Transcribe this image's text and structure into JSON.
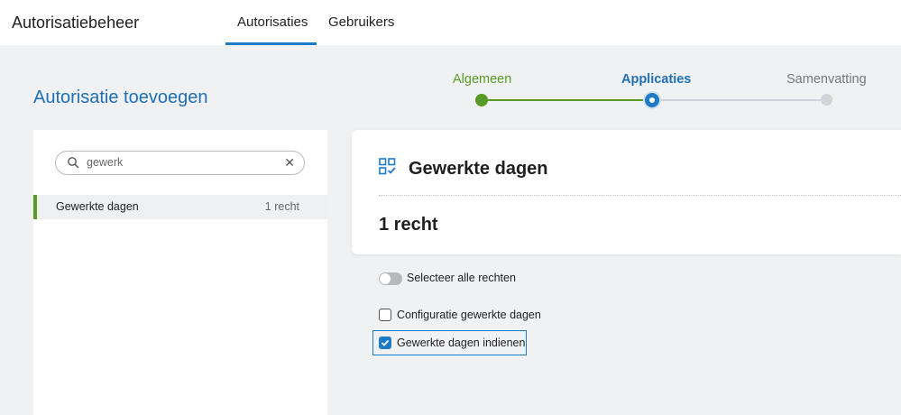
{
  "header": {
    "app_title": "Autorisatiebeheer",
    "tabs": [
      {
        "label": "Autorisaties",
        "active": true
      },
      {
        "label": "Gebruikers",
        "active": false
      }
    ]
  },
  "page": {
    "title": "Autorisatie toevoegen"
  },
  "stepper": {
    "steps": [
      {
        "label": "Algemeen",
        "state": "done"
      },
      {
        "label": "Applicaties",
        "state": "current"
      },
      {
        "label": "Samenvatting",
        "state": "todo"
      }
    ]
  },
  "sidebar": {
    "search": {
      "value": "gewerk",
      "icon": "search-icon",
      "clear_icon": "close-icon"
    },
    "items": [
      {
        "label": "Gewerkte dagen",
        "count": "1 recht",
        "selected": true
      }
    ]
  },
  "detail": {
    "icon": "grid-check-icon",
    "title": "Gewerkte dagen",
    "count": "1 recht",
    "select_all_label": "Selecteer alle rechten",
    "select_all_on": false,
    "rights": [
      {
        "label": "Configuratie gewerkte dagen",
        "checked": false
      },
      {
        "label": "Gewerkte dagen indienen",
        "checked": true
      }
    ]
  },
  "colors": {
    "accent_blue": "#1e7bc6",
    "done_green": "#5a9a26",
    "background": "#f0f1f3"
  }
}
